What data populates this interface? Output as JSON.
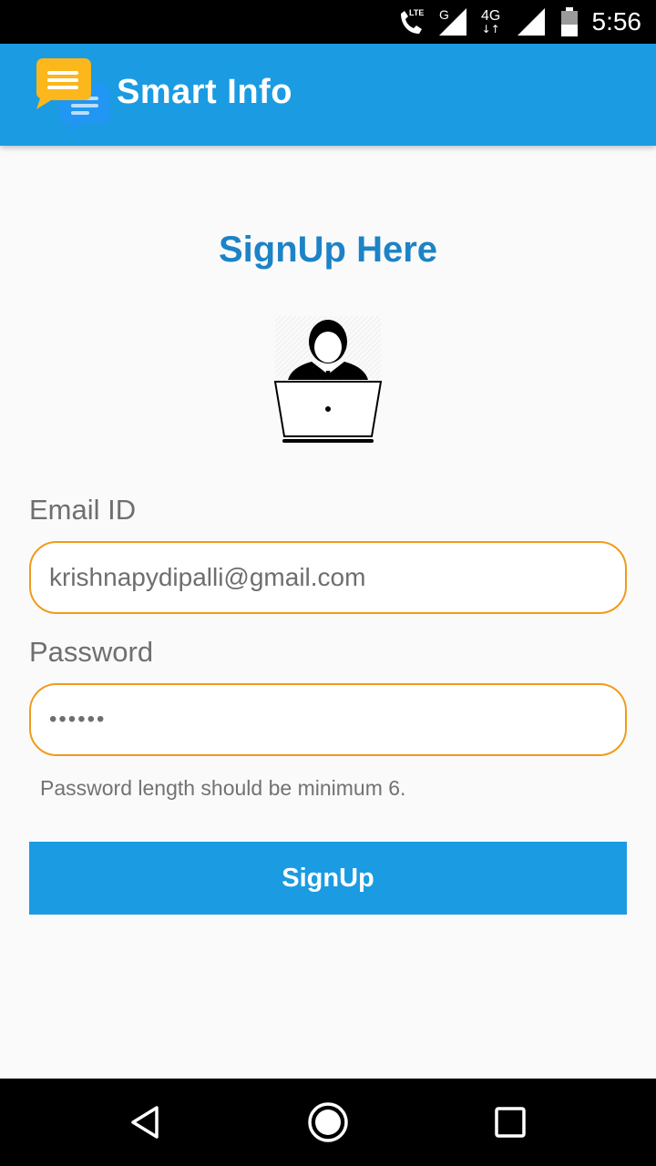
{
  "status_bar": {
    "time": "5:56",
    "network_1": "G",
    "network_2": "4G",
    "call_badge": "LTE",
    "icons": [
      "phone-lte-icon",
      "signal-icon",
      "signal-icon",
      "battery-icon"
    ]
  },
  "app_bar": {
    "title": "Smart Info",
    "logo_icon": "chat-bubbles-icon"
  },
  "page": {
    "heading": "SignUp Here",
    "illustration": "user-laptop-icon"
  },
  "form": {
    "email_label": "Email ID",
    "email_value": "krishnapydipalli@gmail.com",
    "password_label": "Password",
    "password_value": "••••••",
    "password_hint": "Password length should be minimum 6.",
    "submit_label": "SignUp"
  },
  "nav_bar": {
    "icons": [
      "back-icon",
      "home-icon",
      "recents-icon"
    ]
  },
  "colors": {
    "accent": "#1b9be2",
    "heading": "#1c83c6",
    "field_border": "#f19b1a"
  }
}
